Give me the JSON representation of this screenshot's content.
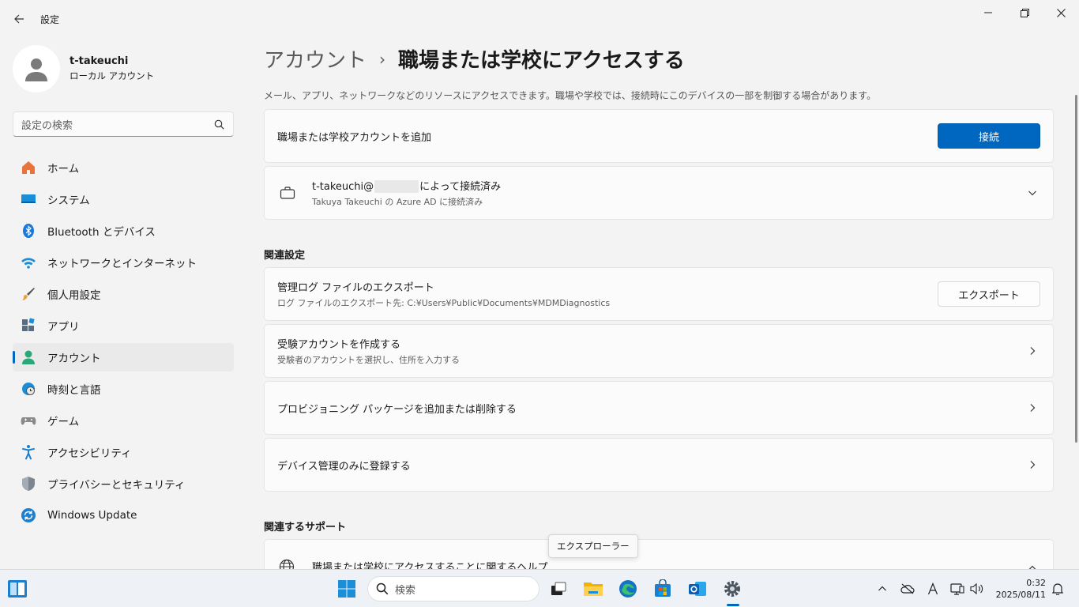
{
  "window": {
    "title": "設定"
  },
  "profile": {
    "name": "t-takeuchi",
    "account_type": "ローカル アカウント"
  },
  "search": {
    "placeholder": "設定の検索"
  },
  "nav": {
    "items": [
      {
        "label": "ホーム",
        "icon": "home-icon"
      },
      {
        "label": "システム",
        "icon": "system-icon"
      },
      {
        "label": "Bluetooth とデバイス",
        "icon": "bluetooth-icon"
      },
      {
        "label": "ネットワークとインターネット",
        "icon": "wifi-icon"
      },
      {
        "label": "個人用設定",
        "icon": "brush-icon"
      },
      {
        "label": "アプリ",
        "icon": "apps-icon"
      },
      {
        "label": "アカウント",
        "icon": "account-icon",
        "active": true
      },
      {
        "label": "時刻と言語",
        "icon": "time-language-icon"
      },
      {
        "label": "ゲーム",
        "icon": "gamepad-icon"
      },
      {
        "label": "アクセシビリティ",
        "icon": "accessibility-icon"
      },
      {
        "label": "プライバシーとセキュリティ",
        "icon": "shield-icon"
      },
      {
        "label": "Windows Update",
        "icon": "update-icon"
      }
    ]
  },
  "main": {
    "breadcrumb": {
      "parent": "アカウント",
      "separator": "›",
      "current": "職場または学校にアクセスする"
    },
    "description": "メール、アプリ、ネットワークなどのリソースにアクセスできます。職場や学校では、接続時にこのデバイスの一部を制御する場合があります。",
    "add_account": {
      "title": "職場または学校アカウントを追加",
      "button": "接続"
    },
    "connected": {
      "user": "t-takeuchi@",
      "status": "によって接続済み",
      "sub": "Takuya Takeuchi の Azure AD に接続済み"
    },
    "related_settings": {
      "heading": "関連設定",
      "export": {
        "title": "管理ログ ファイルのエクスポート",
        "sub": "ログ ファイルのエクスポート先: C:¥Users¥Public¥Documents¥MDMDiagnostics",
        "button": "エクスポート"
      },
      "exam": {
        "title": "受験アカウントを作成する",
        "sub": "受験者のアカウントを選択し、住所を入力する"
      },
      "provisioning": {
        "title": "プロビジョニング パッケージを追加または削除する"
      },
      "enroll": {
        "title": "デバイス管理のみに登録する"
      }
    },
    "support": {
      "heading": "関連するサポート",
      "help_title": "職場または学校にアクセスすることに関するヘルプ"
    }
  },
  "tooltip": {
    "text": "エクスプローラー"
  },
  "taskbar": {
    "search_placeholder": "検索",
    "time": "0:32",
    "date": "2025/08/11"
  },
  "colors": {
    "accent": "#0067c0",
    "background": "#f3f3f3",
    "card": "#fbfbfb"
  }
}
